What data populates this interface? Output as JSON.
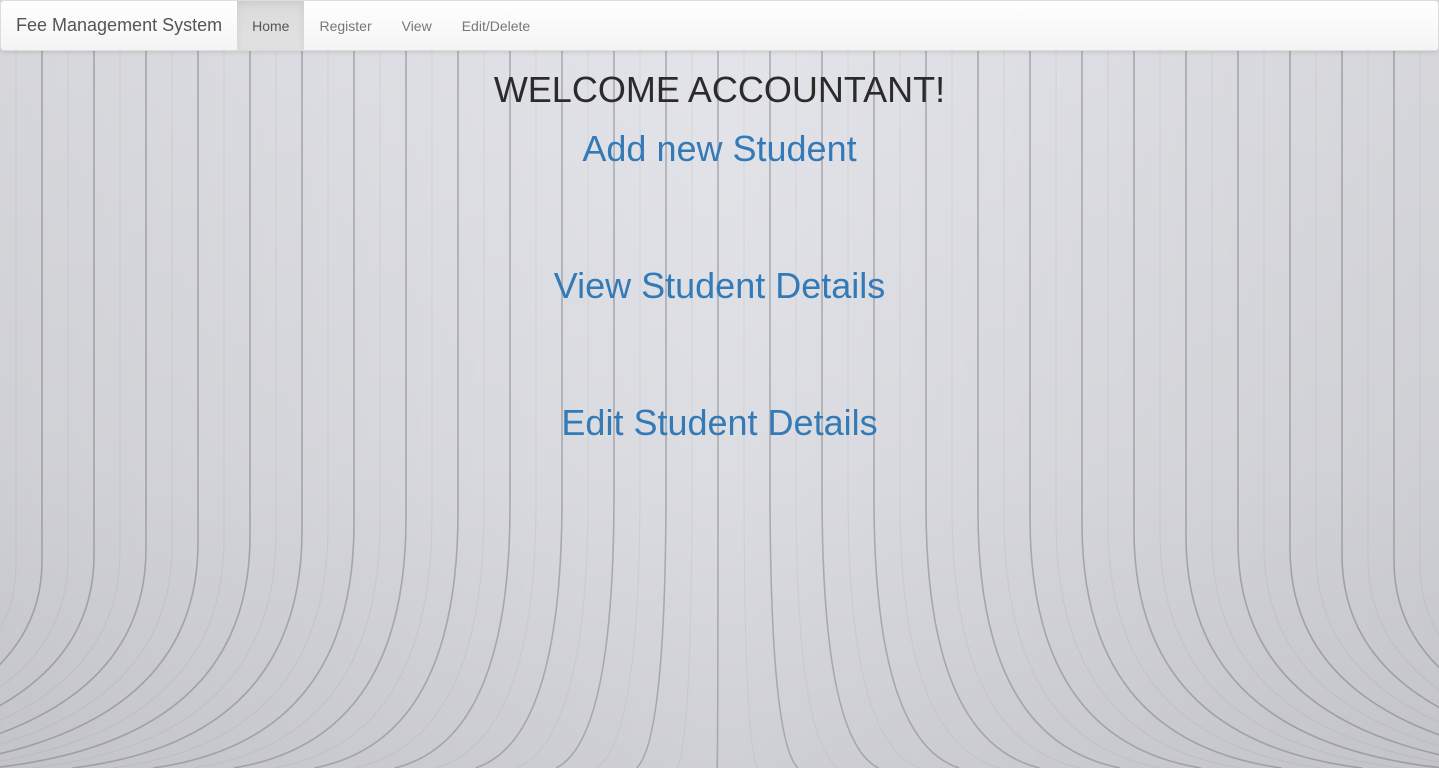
{
  "navbar": {
    "brand": "Fee Management System",
    "items": [
      {
        "label": "Home",
        "active": true
      },
      {
        "label": "Register",
        "active": false
      },
      {
        "label": "View",
        "active": false
      },
      {
        "label": "Edit/Delete",
        "active": false
      }
    ]
  },
  "main": {
    "heading": "WELCOME ACCOUNTANT!",
    "links": {
      "add_student": "Add new Student",
      "view_student": "View Student Details",
      "edit_student": "Edit Student Details"
    }
  },
  "colors": {
    "link": "#337ab7",
    "heading": "#2b2b2b",
    "navbar_bg": "#f8f8f8",
    "background": "#dcdde2"
  },
  "background_image": "curved-wooden-planks"
}
